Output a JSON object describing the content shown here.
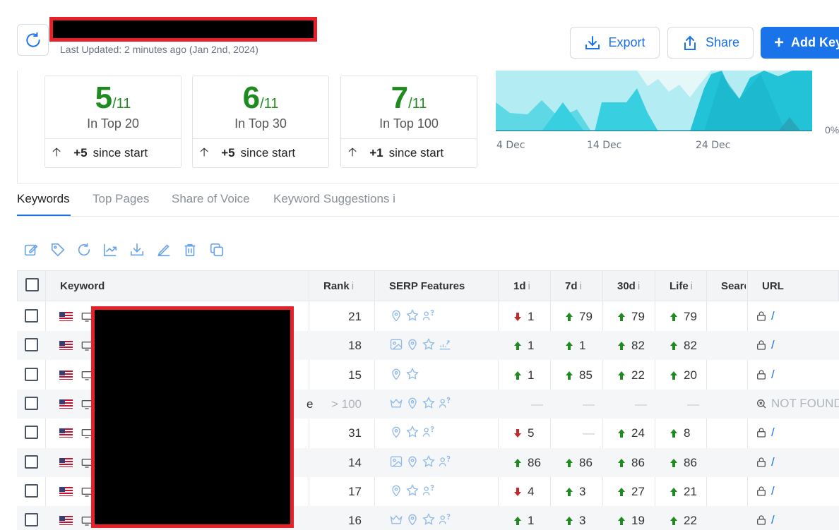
{
  "header": {
    "last_updated": "Last Updated: 2 minutes ago (Jan 2nd, 2024)",
    "export_label": "Export",
    "share_label": "Share",
    "add_label": "Add Keywords"
  },
  "stats": [
    {
      "value": "5",
      "total": "/11",
      "label": "In Top 20",
      "delta": "+5",
      "delta_suffix": "since start"
    },
    {
      "value": "6",
      "total": "/11",
      "label": "In Top 30",
      "delta": "+5",
      "delta_suffix": "since start"
    },
    {
      "value": "7",
      "total": "/11",
      "label": "In Top 100",
      "delta": "+1",
      "delta_suffix": "since start"
    }
  ],
  "chart": {
    "x_ticks": [
      "4 Dec",
      "14 Dec",
      "24 Dec"
    ],
    "y_tick": "0%"
  },
  "tabs": [
    "Keywords",
    "Top Pages",
    "Share of Voice",
    "Keyword Suggestions i"
  ],
  "table": {
    "columns": {
      "keyword": "Keyword",
      "rank": "Rank",
      "serp": "SERP Features",
      "d1": "1d",
      "d7": "7d",
      "d30": "30d",
      "life": "Life",
      "search": "Searc",
      "url": "URL"
    },
    "info_glyph": "i",
    "rows": [
      {
        "rank": "21",
        "d1": {
          "dir": "down",
          "v": "1"
        },
        "d7": {
          "dir": "up",
          "v": "79"
        },
        "d30": {
          "dir": "up",
          "v": "79"
        },
        "life": {
          "dir": "up",
          "v": "79"
        },
        "url": "/",
        "serp": [
          "pin-icon",
          "star-icon",
          "people-ask-icon"
        ]
      },
      {
        "rank": "18",
        "d1": {
          "dir": "up",
          "v": "1"
        },
        "d7": {
          "dir": "up",
          "v": "1"
        },
        "d30": {
          "dir": "up",
          "v": "82"
        },
        "life": {
          "dir": "up",
          "v": "82"
        },
        "url": "/",
        "serp": [
          "image-icon",
          "pin-icon",
          "star-icon",
          "trend-icon"
        ]
      },
      {
        "rank": "15",
        "d1": {
          "dir": "up",
          "v": "1"
        },
        "d7": {
          "dir": "up",
          "v": "85"
        },
        "d30": {
          "dir": "up",
          "v": "22"
        },
        "life": {
          "dir": "up",
          "v": "20"
        },
        "url": "/",
        "serp": [
          "pin-icon",
          "star-icon"
        ]
      },
      {
        "rank": "> 100",
        "d1": null,
        "d7": null,
        "d30": null,
        "life": null,
        "url": "NOT FOUND",
        "kw_tail": "e",
        "serp": [
          "crown-icon",
          "pin-icon",
          "star-icon",
          "people-ask-icon"
        ]
      },
      {
        "rank": "31",
        "d1": {
          "dir": "down",
          "v": "5"
        },
        "d7": null,
        "d30": {
          "dir": "up",
          "v": "24"
        },
        "life": {
          "dir": "up",
          "v": "8"
        },
        "url": "/",
        "serp": [
          "pin-icon",
          "star-icon",
          "people-ask-icon"
        ]
      },
      {
        "rank": "14",
        "d1": {
          "dir": "up",
          "v": "86"
        },
        "d7": {
          "dir": "up",
          "v": "86"
        },
        "d30": {
          "dir": "up",
          "v": "86"
        },
        "life": {
          "dir": "up",
          "v": "86"
        },
        "url": "/",
        "serp": [
          "image-icon",
          "pin-icon",
          "star-icon",
          "people-ask-icon"
        ]
      },
      {
        "rank": "17",
        "d1": {
          "dir": "down",
          "v": "4"
        },
        "d7": {
          "dir": "up",
          "v": "3"
        },
        "d30": {
          "dir": "up",
          "v": "27"
        },
        "life": {
          "dir": "up",
          "v": "21"
        },
        "url": "/",
        "serp": [
          "pin-icon",
          "star-icon",
          "people-ask-icon"
        ]
      },
      {
        "rank": "16",
        "d1": {
          "dir": "up",
          "v": "1"
        },
        "d7": {
          "dir": "up",
          "v": "3"
        },
        "d30": {
          "dir": "up",
          "v": "19"
        },
        "life": {
          "dir": "up",
          "v": "22"
        },
        "url": "/",
        "serp": [
          "crown-icon",
          "pin-icon",
          "star-icon",
          "people-ask-icon"
        ]
      }
    ]
  },
  "colors": {
    "accent": "#1a73e8",
    "up": "#1f8a1f",
    "down": "#c62828",
    "icon": "#8fb9e8"
  }
}
